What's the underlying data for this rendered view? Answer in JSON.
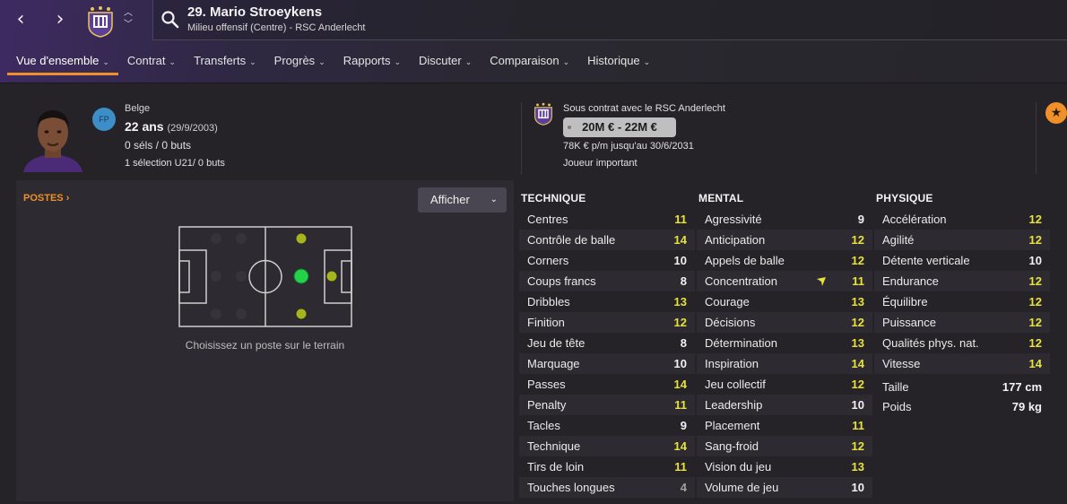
{
  "header": {
    "player_title": "29. Mario Stroeykens",
    "player_subtitle": "Milieu offensif (Centre) - RSC Anderlecht",
    "tabs": [
      {
        "label": "Vue d'ensemble"
      },
      {
        "label": "Contrat"
      },
      {
        "label": "Transferts"
      },
      {
        "label": "Progrès"
      },
      {
        "label": "Rapports"
      },
      {
        "label": "Discuter"
      },
      {
        "label": "Comparaison"
      },
      {
        "label": "Historique"
      }
    ],
    "active_tab": "Vue d'ensemble",
    "icons": [
      "back-arrow-icon",
      "forward-arrow-icon",
      "club-crest-icon",
      "updown-icon",
      "search-icon"
    ]
  },
  "profile": {
    "nationality_badge": "FP",
    "nationality": "Belge",
    "age": "22 ans",
    "birth_date": "(29/9/2003)",
    "caps": "0 séls / 0 buts",
    "u21": "1 sélection U21/ 0 buts"
  },
  "contract": {
    "club_line": "Sous contrat avec le RSC Anderlecht",
    "value_range": "20M € - 22M €",
    "wage_line": "78K € p/m jusqu'au 30/6/2031",
    "status": "Joueur important"
  },
  "positions": {
    "label": "POSTES",
    "label_arrow": "›",
    "display_button": "Afficher",
    "hint": "Choisissez un poste sur le terrain"
  },
  "colors": {
    "accent": "#f0902a",
    "attr_high": "#e8e23a",
    "attr_mid": "#f2f2f2",
    "attr_low": "#a0a0a0",
    "position_natural": "#22d34a",
    "position_accomplished": "#a7b51d"
  },
  "attributes": {
    "technique": {
      "title": "TECHNIQUE",
      "rows": [
        {
          "name": "Centres",
          "value": "11"
        },
        {
          "name": "Contrôle de balle",
          "value": "14"
        },
        {
          "name": "Corners",
          "value": "10"
        },
        {
          "name": "Coups francs",
          "value": "8"
        },
        {
          "name": "Dribbles",
          "value": "13"
        },
        {
          "name": "Finition",
          "value": "12"
        },
        {
          "name": "Jeu de tête",
          "value": "8"
        },
        {
          "name": "Marquage",
          "value": "10"
        },
        {
          "name": "Passes",
          "value": "14"
        },
        {
          "name": "Penalty",
          "value": "11"
        },
        {
          "name": "Tacles",
          "value": "9"
        },
        {
          "name": "Technique",
          "value": "14"
        },
        {
          "name": "Tirs de loin",
          "value": "11"
        },
        {
          "name": "Touches longues",
          "value": "4"
        }
      ]
    },
    "mental": {
      "title": "MENTAL",
      "rows": [
        {
          "name": "Agressivité",
          "value": "9"
        },
        {
          "name": "Anticipation",
          "value": "12"
        },
        {
          "name": "Appels de balle",
          "value": "12"
        },
        {
          "name": "Concentration",
          "value": "11"
        },
        {
          "name": "Courage",
          "value": "13"
        },
        {
          "name": "Décisions",
          "value": "12"
        },
        {
          "name": "Détermination",
          "value": "13"
        },
        {
          "name": "Inspiration",
          "value": "14"
        },
        {
          "name": "Jeu collectif",
          "value": "12"
        },
        {
          "name": "Leadership",
          "value": "10"
        },
        {
          "name": "Placement",
          "value": "11"
        },
        {
          "name": "Sang-froid",
          "value": "12"
        },
        {
          "name": "Vision du jeu",
          "value": "13"
        },
        {
          "name": "Volume de jeu",
          "value": "10"
        }
      ]
    },
    "physique": {
      "title": "PHYSIQUE",
      "rows": [
        {
          "name": "Accélération",
          "value": "12"
        },
        {
          "name": "Agilité",
          "value": "12"
        },
        {
          "name": "Détente verticale",
          "value": "10"
        },
        {
          "name": "Endurance",
          "value": "12"
        },
        {
          "name": "Équilibre",
          "value": "12"
        },
        {
          "name": "Puissance",
          "value": "12"
        },
        {
          "name": "Qualités phys. nat.",
          "value": "12"
        },
        {
          "name": "Vitesse",
          "value": "14"
        }
      ],
      "extra": [
        {
          "name": "Taille",
          "value": "177 cm"
        },
        {
          "name": "Poids",
          "value": "79 kg"
        }
      ]
    }
  }
}
